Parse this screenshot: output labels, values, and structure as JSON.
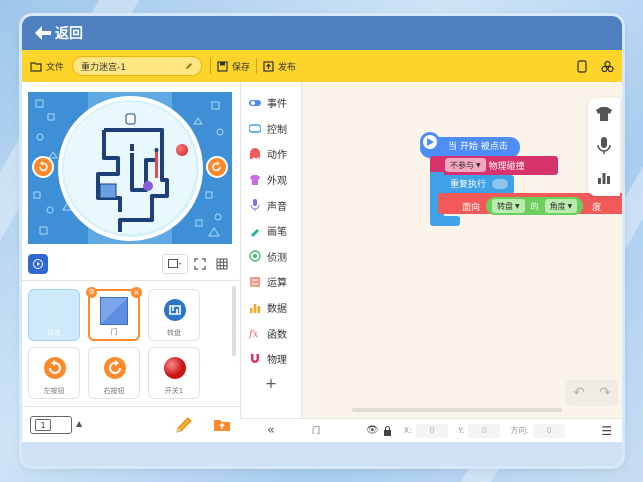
{
  "header": {
    "back_label": "返回"
  },
  "toolbar": {
    "file_label": "文件",
    "project_name": "重力迷宫-1",
    "save_label": "保存",
    "publish_label": "发布"
  },
  "categories": [
    {
      "label": "事件",
      "color": "#4d8df5"
    },
    {
      "label": "控制",
      "color": "#3fa1e8"
    },
    {
      "label": "动作",
      "color": "#f25a5a"
    },
    {
      "label": "外观",
      "color": "#c86ce0"
    },
    {
      "label": "声音",
      "color": "#8a6cf0"
    },
    {
      "label": "画笔",
      "color": "#21b5a0"
    },
    {
      "label": "侦测",
      "color": "#3fc46a"
    },
    {
      "label": "运算",
      "color": "#f59a8a"
    },
    {
      "label": "数据",
      "color": "#f5a623"
    },
    {
      "label": "函数",
      "color": "#ef6b6b"
    },
    {
      "label": "物理",
      "color": "#d6336c"
    }
  ],
  "sprites": [
    {
      "label": "背景"
    },
    {
      "label": "门"
    },
    {
      "label": "转盘"
    },
    {
      "label": "左按钮"
    },
    {
      "label": "右按钮"
    },
    {
      "label": "开关1"
    }
  ],
  "blocks": {
    "hat": "当 开始 被点击",
    "physics_dropdown": "不参与",
    "physics_label": "物理碰撞",
    "loop_label": "重复执行",
    "face_label": "面向",
    "sprite_dropdown": "转盘",
    "of_label": "的",
    "attr_dropdown": "角度",
    "degree_label": "度"
  },
  "properties": {
    "sprite_name": "门",
    "x_label": "X:",
    "x_value": "0",
    "y_label": "Y:",
    "y_value": "0",
    "direction_label": "方向:",
    "direction_value": "0"
  },
  "page_selector": "1",
  "colors": {
    "topbar": "#4d80bf",
    "toolbar": "#ffd42a",
    "event_block": "#4d8df5",
    "physics_block": "#d6336c",
    "control_block": "#3fa1e8",
    "motion_block": "#f25a5a",
    "sensing_chip": "#6ccf5c"
  }
}
